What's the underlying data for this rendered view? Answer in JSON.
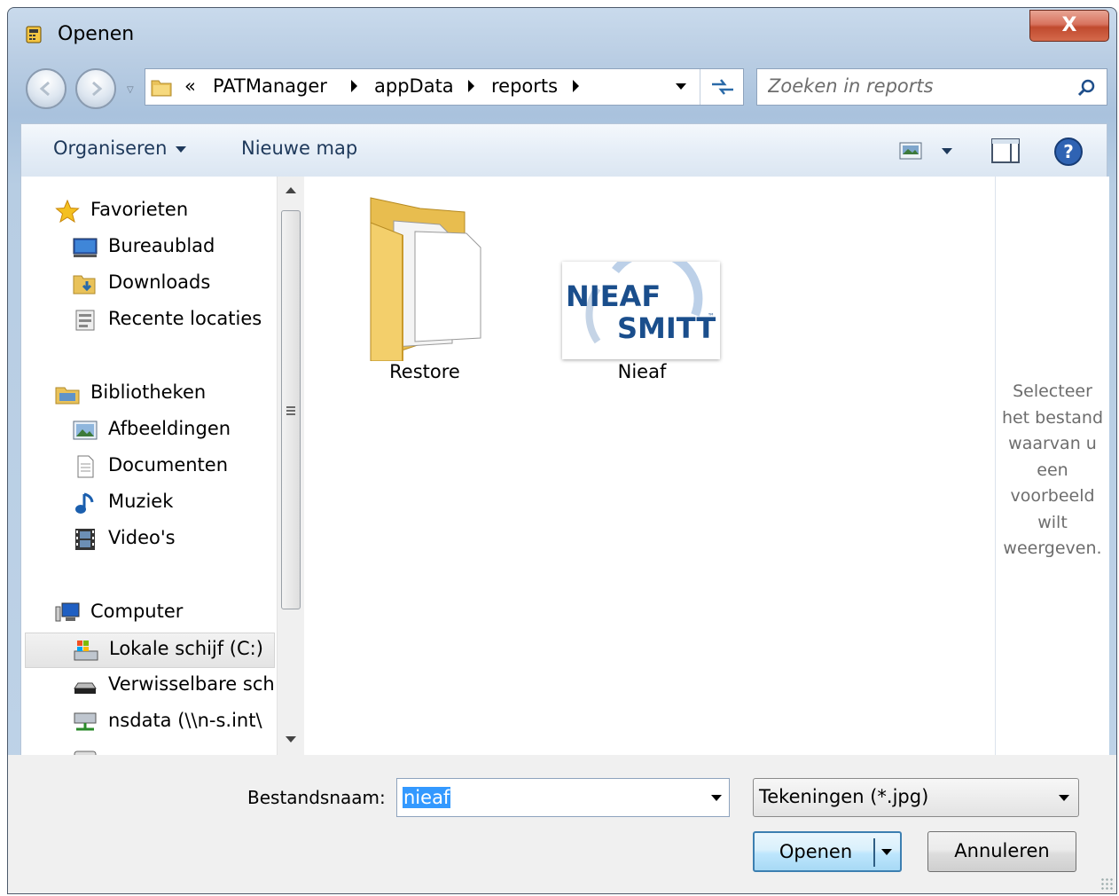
{
  "window": {
    "title": "Openen",
    "close_label": "X"
  },
  "address": {
    "overflow": "«",
    "crumbs": [
      "PATManager",
      "appData",
      "reports"
    ]
  },
  "search": {
    "placeholder": "Zoeken in reports"
  },
  "toolbar": {
    "organize": "Organiseren",
    "new_folder": "Nieuwe map"
  },
  "navigation": {
    "favorites": {
      "label": "Favorieten",
      "items": [
        "Bureaublad",
        "Downloads",
        "Recente locaties"
      ]
    },
    "libraries": {
      "label": "Bibliotheken",
      "items": [
        "Afbeeldingen",
        "Documenten",
        "Muziek",
        "Video's"
      ]
    },
    "computer": {
      "label": "Computer",
      "items": [
        "Lokale schijf (C:)",
        "Verwisselbare sch",
        "nsdata (\\\\n-s.int\\"
      ]
    },
    "selected": "Lokale schijf (C:)"
  },
  "files": [
    {
      "name": "Restore",
      "type": "folder"
    },
    {
      "name": "Nieaf",
      "type": "image",
      "logo_line1": "NIEAF",
      "logo_line2": "SMITT",
      "logo_tm": "™"
    }
  ],
  "preview": {
    "message": [
      "Selecteer",
      "het bestand",
      "waarvan u",
      "een",
      "voorbeeld",
      "wilt",
      "weergeven."
    ]
  },
  "filename": {
    "label": "Bestandsnaam:",
    "value": "nieaf"
  },
  "filter": {
    "value": "Tekeningen (*.jpg)"
  },
  "buttons": {
    "open": "Openen",
    "cancel": "Annuleren"
  },
  "colors": {
    "accent": "#1e395b",
    "selection": "#3399ff",
    "logo_blue": "#1a4e8c"
  }
}
